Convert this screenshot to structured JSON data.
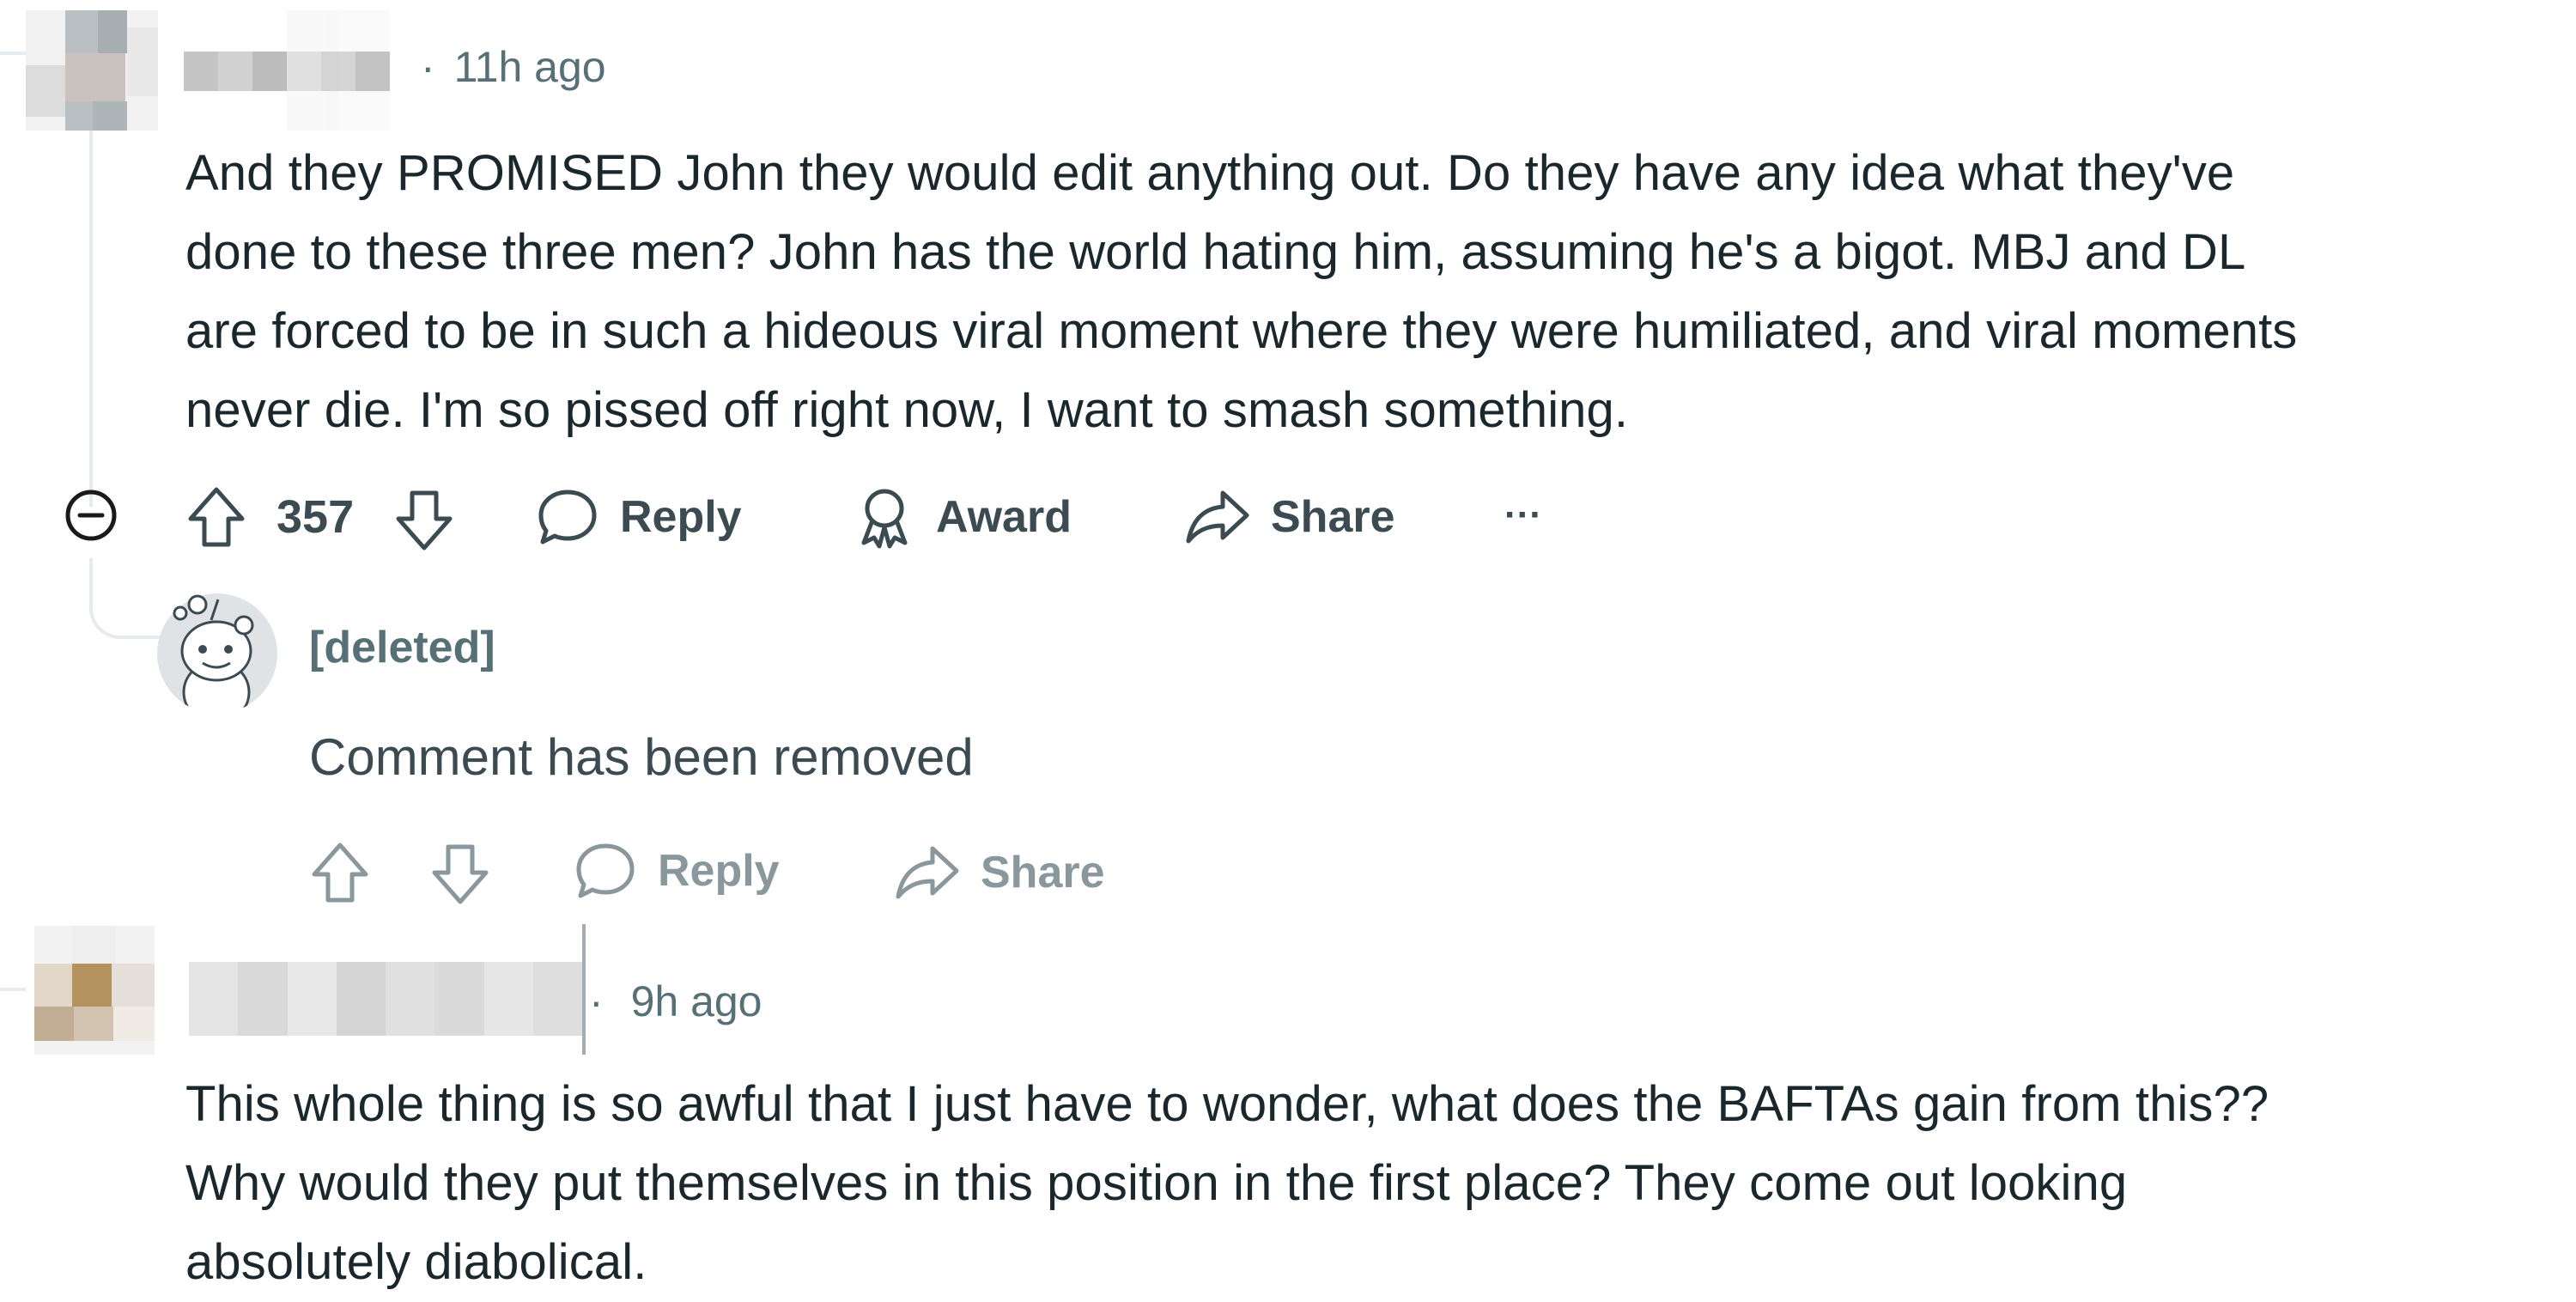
{
  "comments": [
    {
      "time": "11h ago",
      "separator": "·",
      "body_lines": [
        "And they PROMISED John they would edit anything out. Do they have any idea what they've",
        "done to these three men? John has the world hating him, assuming he's a bigot. MBJ and DL",
        "are forced to be in such a hideous viral moment where they were humiliated, and viral moments",
        "never die. I'm so pissed off right now, I want to smash something."
      ],
      "actions": {
        "score": "357",
        "reply": "Reply",
        "award": "Award",
        "share": "Share",
        "more": "···"
      }
    },
    {
      "author": "[deleted]",
      "body": "Comment has been removed",
      "actions": {
        "reply": "Reply",
        "share": "Share"
      }
    },
    {
      "time": "9h ago",
      "separator": "·",
      "body_lines": [
        "This whole thing is so awful that I just have to wonder, what does the BAFTAs gain from this??",
        "Why would they put themselves in this position in the first place? They come out looking",
        "absolutely diabolical."
      ]
    }
  ],
  "icons": {
    "collapse": "collapse-minus-icon",
    "upvote": "upvote-arrow-icon",
    "downvote": "downvote-arrow-icon",
    "reply": "speech-bubble-icon",
    "award": "award-ribbon-icon",
    "share": "share-arrow-icon"
  },
  "colors": {
    "text_primary": "#1a282d",
    "text_meta": "#576f76",
    "text_muted": "#8a979c",
    "thread_line": "#e5ebee"
  }
}
